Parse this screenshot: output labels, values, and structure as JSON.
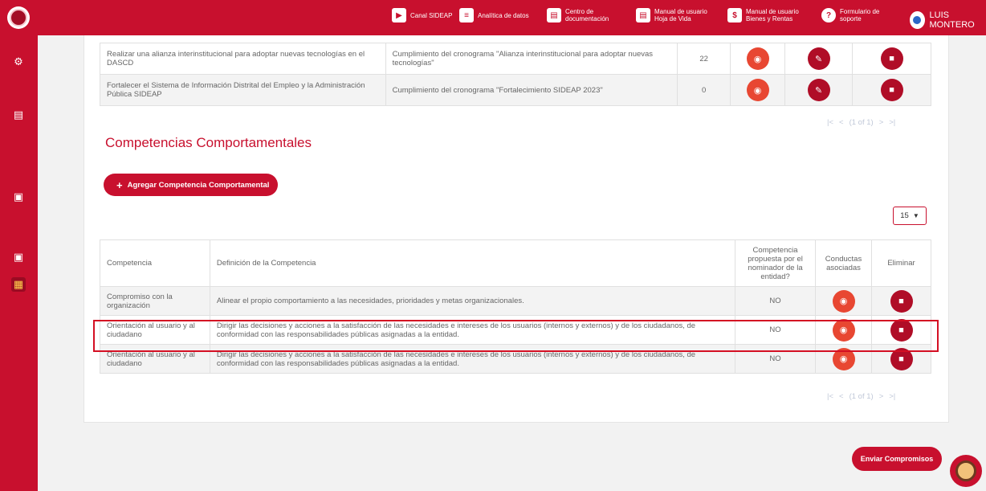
{
  "topbar": {
    "items": [
      {
        "icon": "video-icon",
        "label": "Canal SIDEAP"
      },
      {
        "icon": "analytics-icon",
        "label": "Analítica de datos"
      },
      {
        "icon": "docs-icon",
        "label": "Centro de\ndocumentación"
      },
      {
        "icon": "manual-icon",
        "label": "Manual de usuario\nHoja de Vida"
      },
      {
        "icon": "manual2-icon",
        "label": "Manual de usuario\nBienes y Rentas"
      },
      {
        "icon": "help-icon",
        "label": "Formulario de\nsoporte"
      }
    ],
    "user_name": "LUIS MONTERO"
  },
  "goals_table": {
    "rows": [
      {
        "actividad": "Realizar una alianza interinstitucional para adoptar nuevas tecnologías en el DASCD",
        "meta": "Cumplimiento del cronograma \"Alianza interinstitucional para adoptar nuevas tecnologías\"",
        "valor": "22"
      },
      {
        "actividad": "Fortalecer el Sistema de Información Distrital del Empleo y la Administración Pública SIDEAP",
        "meta": "Cumplimiento del cronograma \"Fortalecimiento SIDEAP 2023\"",
        "valor": "0"
      }
    ],
    "pager": {
      "first": "|<",
      "prev": "<",
      "status": "(1 of 1)",
      "next": ">",
      "last": ">|"
    }
  },
  "competencias": {
    "title": "Competencias Comportamentales",
    "add_button": "Agregar Competencia Comportamental",
    "page_size": "15",
    "headers": {
      "competencia": "Competencia",
      "definicion": "Definición de la Competencia",
      "propuesta": "Competencia propuesta por el nominador de la entidad?",
      "conductas": "Conductas asociadas",
      "eliminar": "Eliminar"
    },
    "rows": [
      {
        "competencia": "Compromiso con la organización",
        "definicion": "Alinear el propio comportamiento a las necesidades, prioridades y metas organizacionales.",
        "propuesta": "NO"
      },
      {
        "competencia": "Orientación al usuario y al ciudadano",
        "definicion": "Dirigir las decisiones y acciones a la satisfacción de las necesidades e intereses de los usuarios (internos y externos) y de los ciudadanos, de conformidad con las responsabilidades públicas asignadas a la entidad.",
        "propuesta": "NO"
      },
      {
        "competencia": "Orientación al usuario y al ciudadano",
        "definicion": "Dirigir las decisiones y acciones a la satisfacción de las necesidades e intereses de los usuarios (internos y externos) y de los ciudadanos, de conformidad con las responsabilidades públicas asignadas a la entidad.",
        "propuesta": "NO"
      }
    ],
    "pager": {
      "first": "|<",
      "prev": "<",
      "status": "(1 of 1)",
      "next": ">",
      "last": ">|"
    }
  },
  "send_button": "Enviar Compromisos",
  "colors": {
    "brand": "#c8102e",
    "action_orange": "#e84732",
    "action_dark": "#b00d27"
  }
}
